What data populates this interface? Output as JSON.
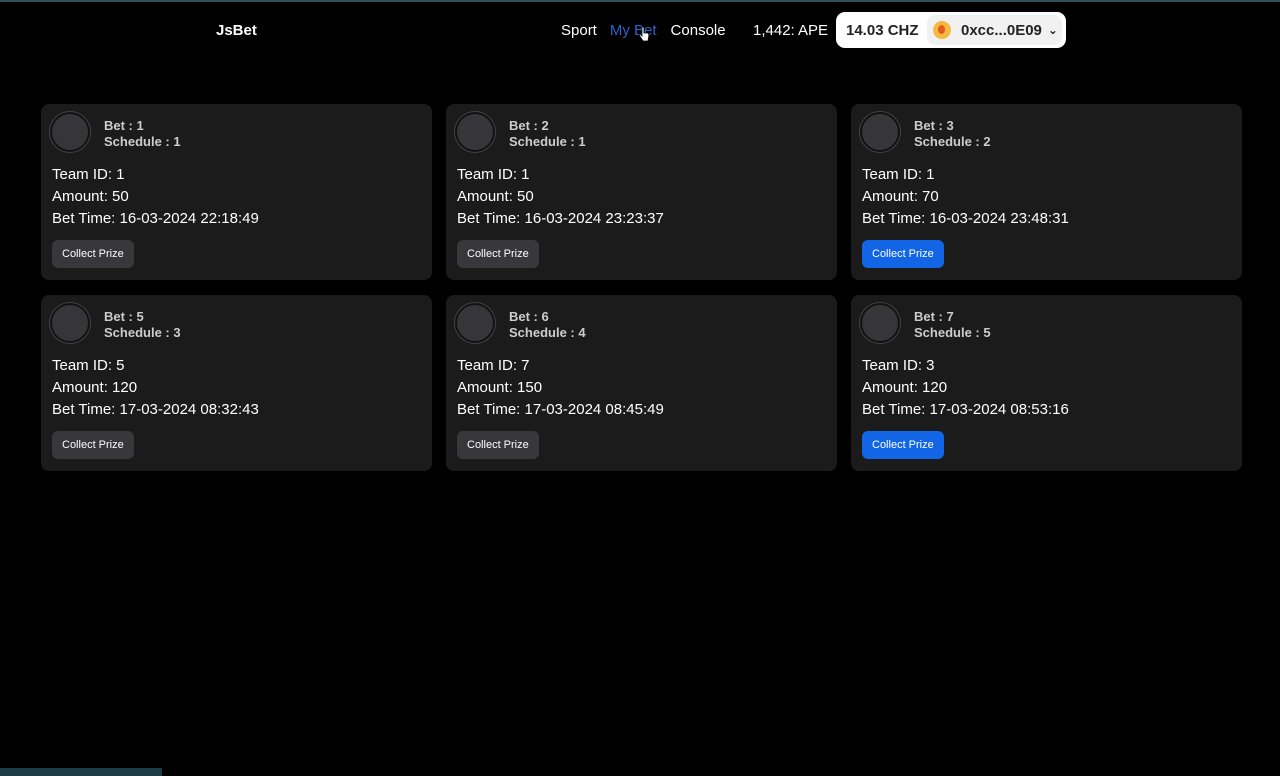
{
  "header": {
    "logo": "JsBet",
    "nav": [
      "Sport",
      "My Bet",
      "Console"
    ],
    "ape_balance": "1,442: APE",
    "chz_balance": "14.03 CHZ",
    "account": "0xcc...0E09"
  },
  "colors": {
    "accent": "#1266e6",
    "active_nav": "#2b63c8"
  },
  "cards": [
    {
      "bet": "Bet : 1",
      "schedule": "Schedule : 1",
      "team": "Team ID: 1",
      "amount": "Amount: 50",
      "time": "Bet Time: 16-03-2024 22:18:49",
      "button": "Collect Prize",
      "active": false
    },
    {
      "bet": "Bet : 2",
      "schedule": "Schedule : 1",
      "team": "Team ID: 1",
      "amount": "Amount: 50",
      "time": "Bet Time: 16-03-2024 23:23:37",
      "button": "Collect Prize",
      "active": false
    },
    {
      "bet": "Bet : 3",
      "schedule": "Schedule : 2",
      "team": "Team ID: 1",
      "amount": "Amount: 70",
      "time": "Bet Time: 16-03-2024 23:48:31",
      "button": "Collect Prize",
      "active": true
    },
    {
      "bet": "Bet : 5",
      "schedule": "Schedule : 3",
      "team": "Team ID: 5",
      "amount": "Amount: 120",
      "time": "Bet Time: 17-03-2024 08:32:43",
      "button": "Collect Prize",
      "active": false
    },
    {
      "bet": "Bet : 6",
      "schedule": "Schedule : 4",
      "team": "Team ID: 7",
      "amount": "Amount: 150",
      "time": "Bet Time: 17-03-2024 08:45:49",
      "button": "Collect Prize",
      "active": false
    },
    {
      "bet": "Bet : 7",
      "schedule": "Schedule : 5",
      "team": "Team ID: 3",
      "amount": "Amount: 120",
      "time": "Bet Time: 17-03-2024 08:53:16",
      "button": "Collect Prize",
      "active": true
    }
  ]
}
